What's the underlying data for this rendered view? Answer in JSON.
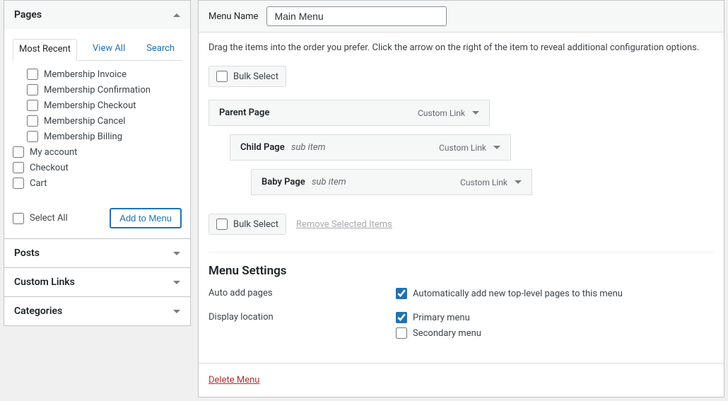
{
  "sidebar": {
    "sections": {
      "pages": {
        "title": "Pages"
      },
      "posts": {
        "title": "Posts"
      },
      "custom_links": {
        "title": "Custom Links"
      },
      "categories": {
        "title": "Categories"
      }
    },
    "tabs": {
      "most_recent": "Most Recent",
      "view_all": "View All",
      "search": "Search"
    },
    "page_items": [
      {
        "label": "Membership Invoice",
        "indent": true
      },
      {
        "label": "Membership Confirmation",
        "indent": true
      },
      {
        "label": "Membership Checkout",
        "indent": true
      },
      {
        "label": "Membership Cancel",
        "indent": true
      },
      {
        "label": "Membership Billing",
        "indent": true
      },
      {
        "label": "My account",
        "indent": false
      },
      {
        "label": "Checkout",
        "indent": false
      },
      {
        "label": "Cart",
        "indent": false
      }
    ],
    "select_all": "Select All",
    "add_to_menu": "Add to Menu"
  },
  "main": {
    "menu_name_label": "Menu Name",
    "menu_name_value": "Main Menu",
    "instructions": "Drag the items into the order you prefer. Click the arrow on the right of the item to reveal additional configuration options.",
    "bulk_select": "Bulk Select",
    "remove_selected": "Remove Selected Items",
    "menu_items": [
      {
        "title": "Parent Page",
        "sub": "",
        "type": "Custom Link",
        "depth": 0
      },
      {
        "title": "Child Page",
        "sub": "sub item",
        "type": "Custom Link",
        "depth": 1
      },
      {
        "title": "Baby Page",
        "sub": "sub item",
        "type": "Custom Link",
        "depth": 2
      }
    ],
    "settings": {
      "heading": "Menu Settings",
      "auto_add_label": "Auto add pages",
      "auto_add_option": "Automatically add new top-level pages to this menu",
      "auto_add_checked": true,
      "display_location_label": "Display location",
      "primary_label": "Primary menu",
      "primary_checked": true,
      "secondary_label": "Secondary menu",
      "secondary_checked": false
    },
    "delete_menu": "Delete Menu"
  }
}
